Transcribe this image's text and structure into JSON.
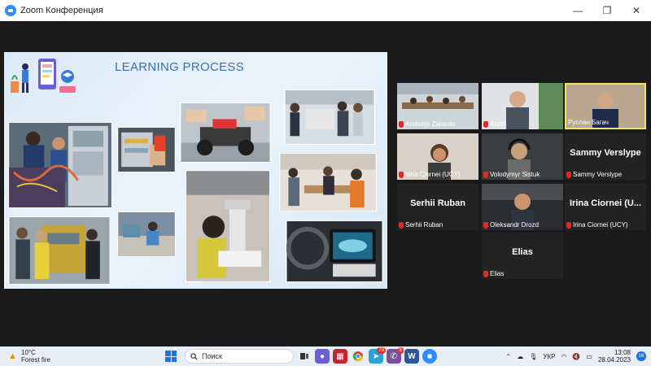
{
  "window": {
    "title": "Zoom Конференция",
    "minimize": "—",
    "maximize": "❐",
    "close": "✕"
  },
  "slide": {
    "title": "LEARNING PROCESS"
  },
  "participants": [
    {
      "name": "Anatolijs Zabasta",
      "video": true,
      "muted": true,
      "active": false
    },
    {
      "name": "Andrii",
      "video": true,
      "muted": true,
      "active": false
    },
    {
      "name": "Руслан Багач",
      "video": true,
      "muted": false,
      "active": true
    },
    {
      "name": "Irina Ciornei (UCY)",
      "video": true,
      "muted": true,
      "active": false
    },
    {
      "name": "Volodymyr Sistuk",
      "video": true,
      "muted": true,
      "active": false
    },
    {
      "name": "Sammy Verslype",
      "display": "Sammy Verslype",
      "video": false,
      "muted": true,
      "active": false
    },
    {
      "name": "Serhii Ruban",
      "display": "Serhii Ruban",
      "video": false,
      "muted": true,
      "active": false
    },
    {
      "name": "Oleksandr Drozd",
      "video": true,
      "muted": true,
      "active": false
    },
    {
      "name": "Irina Ciornei (UCY)",
      "display": "Irina Ciornei (U...",
      "video": false,
      "muted": true,
      "active": false
    },
    {
      "name": "Elias",
      "display": "Elias",
      "video": false,
      "muted": true,
      "active": false
    }
  ],
  "taskbar": {
    "weather_temp": "10°C",
    "weather_desc": "Forest fire",
    "search_placeholder": "Поиск",
    "telegram_badge": "73",
    "viber_badge": "6",
    "language": "УКР",
    "time": "13:08",
    "date": "28.04.2023",
    "notifications": "16"
  }
}
